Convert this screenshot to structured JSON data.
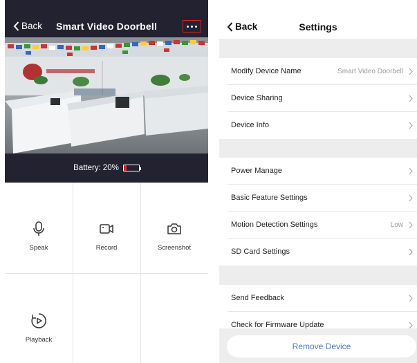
{
  "left": {
    "back_label": "Back",
    "title": "Smart  Video Doorbell",
    "more_icon": "more-horizontal-icon",
    "battery": {
      "label": "Battery:",
      "percent_text": "20%",
      "level": 0.2,
      "color": "#e42525"
    },
    "controls": [
      {
        "label": "Speak",
        "icon": "microphone-icon"
      },
      {
        "label": "Record",
        "icon": "video-camera-icon"
      },
      {
        "label": "Screenshot",
        "icon": "camera-icon"
      },
      {
        "label": "Playback",
        "icon": "playback-icon"
      }
    ]
  },
  "right": {
    "back_label": "Back",
    "title": "Settings",
    "group1": [
      {
        "label": "Modify Device Name",
        "value": "Smart  Video Doorbell"
      },
      {
        "label": "Device Sharing",
        "value": ""
      },
      {
        "label": "Device Info",
        "value": ""
      }
    ],
    "group2": [
      {
        "label": "Power Manage",
        "value": ""
      },
      {
        "label": "Basic Feature Settings",
        "value": ""
      },
      {
        "label": "Motion Detection Settings",
        "value": "Low"
      },
      {
        "label": "SD Card Settings",
        "value": ""
      }
    ],
    "group3": [
      {
        "label": "Send Feedback",
        "value": ""
      },
      {
        "label": "Check for Firmware Update",
        "value": ""
      }
    ],
    "remove_label": "Remove Device"
  },
  "colors": {
    "header_bg": "#222231",
    "accent_red": "#e02020",
    "link_blue": "#4e74d6",
    "section_gap": "#ededed"
  }
}
